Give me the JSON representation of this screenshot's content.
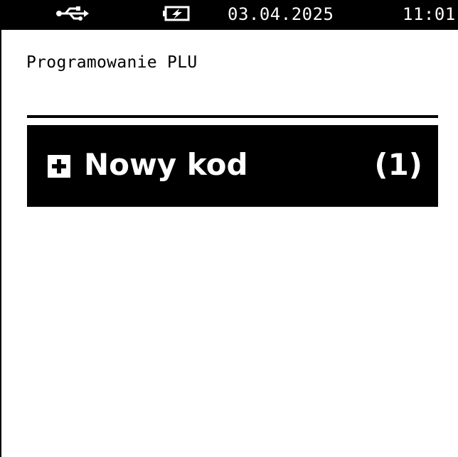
{
  "status_bar": {
    "usb_icon": "usb-icon",
    "battery_icon": "battery-charging-icon",
    "date": "03.04.2025",
    "time": "11:01"
  },
  "page": {
    "title": "Programowanie PLU"
  },
  "menu": {
    "items": [
      {
        "icon": "plus-box-icon",
        "label": "Nowy kod",
        "shortcut": "(1)",
        "selected": true
      }
    ]
  },
  "colors": {
    "background": "#ffffff",
    "foreground": "#000000",
    "highlight_background": "#000000",
    "highlight_foreground": "#ffffff"
  }
}
